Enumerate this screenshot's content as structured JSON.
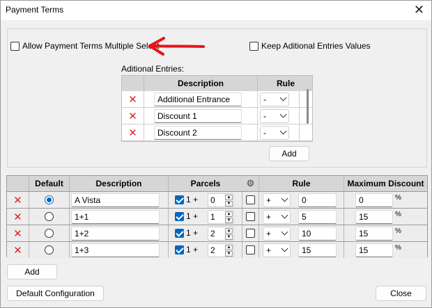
{
  "window": {
    "title": "Payment Terms",
    "close_glyph": "✕"
  },
  "options": {
    "allow_multi_label": "Allow Payment Terms Multiple Select",
    "allow_multi_checked": false,
    "keep_additional_label": "Keep Aditional Entries Values",
    "keep_additional_checked": false
  },
  "annotation": {
    "arrow_color": "#e8141a"
  },
  "additional": {
    "label": "Aditional Entries:",
    "headers": {
      "description": "Description",
      "rule": "Rule"
    },
    "rows": [
      {
        "description": "Additional Entrance",
        "rule": "-"
      },
      {
        "description": "Discount 1",
        "rule": "-"
      },
      {
        "description": "Discount 2",
        "rule": "-"
      }
    ],
    "add_label": "Add"
  },
  "terms": {
    "headers": {
      "default": "Default",
      "description": "Description",
      "parcels": "Parcels",
      "rule": "Rule",
      "maximum_discount": "Maximum Discount"
    },
    "rows": [
      {
        "default": true,
        "description": "A Vista",
        "parcels_checked": true,
        "parcels_prefix": "1 +",
        "parcels_value": "0",
        "extra_checked": false,
        "rule_op": "+",
        "rule_value": "0",
        "max_discount": "0",
        "unit": "%"
      },
      {
        "default": false,
        "description": "1+1",
        "parcels_checked": true,
        "parcels_prefix": "1 +",
        "parcels_value": "1",
        "extra_checked": false,
        "rule_op": "+",
        "rule_value": "5",
        "max_discount": "15",
        "unit": "%"
      },
      {
        "default": false,
        "description": "1+2",
        "parcels_checked": true,
        "parcels_prefix": "1 +",
        "parcels_value": "2",
        "extra_checked": false,
        "rule_op": "+",
        "rule_value": "10",
        "max_discount": "15",
        "unit": "%"
      },
      {
        "default": false,
        "description": "1+3",
        "parcels_checked": true,
        "parcels_prefix": "1 +",
        "parcels_value": "2",
        "extra_checked": false,
        "rule_op": "+",
        "rule_value": "15",
        "max_discount": "15",
        "unit": "%"
      }
    ]
  },
  "footer": {
    "add_label": "Add",
    "default_config_label": "Default Configuration",
    "close_label": "Close"
  },
  "icons": {
    "delete": "red-x-icon",
    "settings": "gear-icon"
  },
  "colors": {
    "accent": "#0067c0",
    "delete": "#dd2222"
  }
}
